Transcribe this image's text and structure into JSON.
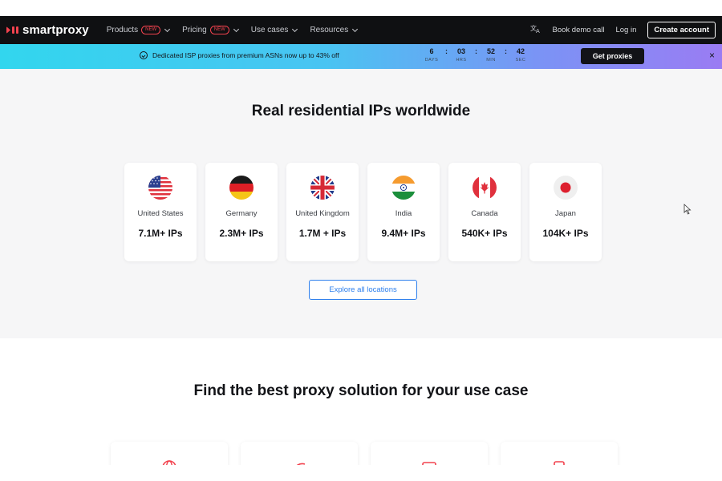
{
  "brand": {
    "name": "smartproxy",
    "accent": "#f2424e"
  },
  "nav": {
    "items": [
      {
        "label": "Products",
        "badge": "NEW",
        "has_dropdown": true
      },
      {
        "label": "Pricing",
        "badge": "NEW",
        "has_dropdown": true
      },
      {
        "label": "Use cases",
        "badge": null,
        "has_dropdown": true
      },
      {
        "label": "Resources",
        "badge": null,
        "has_dropdown": true
      }
    ],
    "translate_icon": "translate-icon",
    "book_demo": "Book demo call",
    "login": "Log in",
    "create_account": "Create account"
  },
  "promo": {
    "message": "Dedicated ISP proxies from premium ASNs now up to 43% off",
    "icon": "badge-check-icon",
    "countdown": [
      {
        "value": "6",
        "label": "DAYS"
      },
      {
        "value": "03",
        "label": "HRS"
      },
      {
        "value": "52",
        "label": "MIN"
      },
      {
        "value": "42",
        "label": "SEC"
      }
    ],
    "button": "Get proxies",
    "close": "×"
  },
  "locations": {
    "title": "Real residential IPs worldwide",
    "cards": [
      {
        "country": "United States",
        "ips": "7.1M+ IPs",
        "flag": "us-flag-icon"
      },
      {
        "country": "Germany",
        "ips": "2.3M+ IPs",
        "flag": "de-flag-icon"
      },
      {
        "country": "United Kingdom",
        "ips": "1.7M + IPs",
        "flag": "uk-flag-icon"
      },
      {
        "country": "India",
        "ips": "9.4M+ IPs",
        "flag": "in-flag-icon"
      },
      {
        "country": "Canada",
        "ips": "540K+ IPs",
        "flag": "ca-flag-icon"
      },
      {
        "country": "Japan",
        "ips": "104K+ IPs",
        "flag": "jp-flag-icon"
      }
    ],
    "explore_button": "Explore all locations"
  },
  "use_cases": {
    "title": "Find the best proxy solution for your use case",
    "card_icons": [
      "globe-icon",
      "signal-icon",
      "browser-icon",
      "document-icon"
    ]
  },
  "colors": {
    "nav_bg": "#0f1012",
    "section_bg": "#f6f6f7",
    "link_blue": "#2f80ed"
  }
}
